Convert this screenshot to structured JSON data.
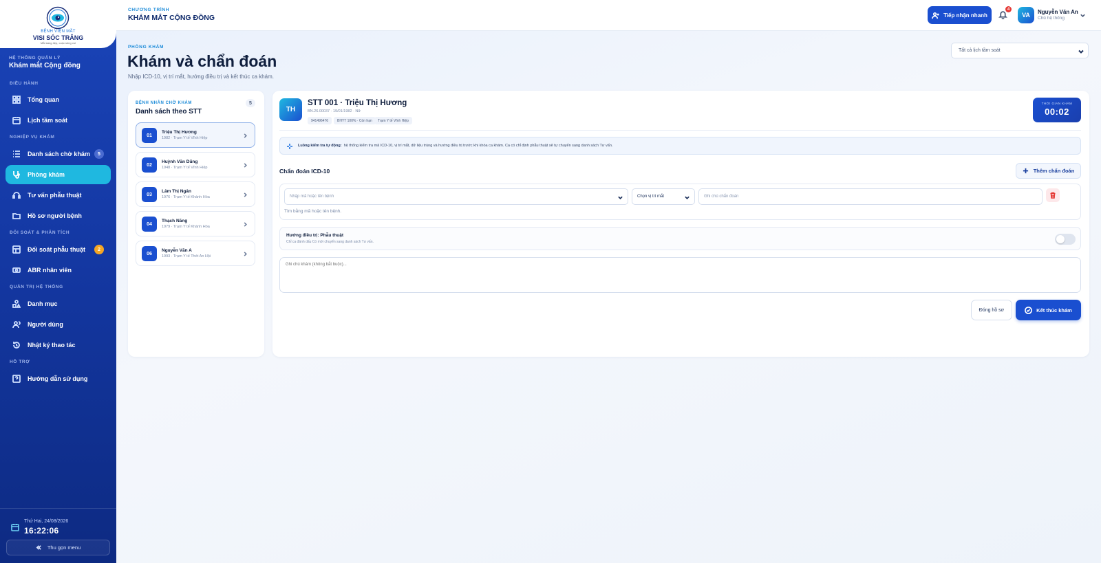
{
  "logo": {
    "line1": "BỆNH VIỆN MẮT",
    "line2": "VISI SÓC TRĂNG",
    "line3": "Mắt sáng đẹp, cuộc sống vui"
  },
  "sidebar": {
    "system_sub": "HỆ THỐNG QUẢN LÝ",
    "system_title": "Khám mắt Cộng đồng",
    "sections": {
      "dieu_hanh": "ĐIỀU HÀNH",
      "nghiep_vu": "NGHIỆP VỤ KHÁM",
      "doi_soat": "ĐỐI SOÁT & PHÂN TÍCH",
      "quan_tri": "QUẢN TRỊ HỆ THỐNG",
      "ho_tro": "HỖ TRỢ"
    },
    "items": {
      "tong_quan": "Tổng quan",
      "lich_tam_soat": "Lịch tầm soát",
      "danh_sach_cho_kham": "Danh sách chờ khám",
      "danh_sach_cho_kham_badge": "5",
      "phong_kham": "Phòng khám",
      "tu_van_phau_thuat": "Tư vấn phẫu thuật",
      "ho_so_nguoi_benh": "Hồ sơ người bệnh",
      "doi_soat_phau_thuat": "Đối soát phẫu thuật",
      "doi_soat_badge": "2",
      "abr_nhan_vien": "ABR nhân viên",
      "danh_muc": "Danh mục",
      "nguoi_dung": "Người dùng",
      "nhat_ky": "Nhật ký thao tác",
      "huong_dan": "Hướng dẫn sử dụng"
    },
    "date": "Thứ Hai, 24/08/2026",
    "time": "16:22:06",
    "collapse": "Thu gọn menu"
  },
  "topbar": {
    "program_sub": "CHƯƠNG TRÌNH",
    "program_title": "KHÁM MẮT CỘNG ĐỒNG",
    "quick_button": "Tiếp nhận nhanh",
    "notif_count": "4",
    "user_initials": "VA",
    "user_name": "Nguyễn Văn An",
    "user_role": "Chủ hệ thống"
  },
  "page": {
    "sub": "PHÒNG KHÁM",
    "title": "Khám và chẩn đoán",
    "desc": "Nhập ICD-10, vị trí mắt, hướng điều trị và kết thúc ca khám.",
    "filter_value": "Tất cả lịch tầm soát"
  },
  "queue": {
    "sub": "BỆNH NHÂN CHỜ KHÁM",
    "title": "Danh sách theo STT",
    "count": "5",
    "patients": [
      {
        "num": "01",
        "name": "Triệu Thị Hương",
        "meta": "1982 · Trạm Y tế Vĩnh Hiệp"
      },
      {
        "num": "02",
        "name": "Huỳnh Văn Dũng",
        "meta": "1948 · Trạm Y tế Vĩnh Hiệp"
      },
      {
        "num": "03",
        "name": "Lâm Thị Ngân",
        "meta": "1976 · Trạm Y tế Khánh Hòa"
      },
      {
        "num": "04",
        "name": "Thạch Năng",
        "meta": "1979 · Trạm Y tế Khánh Hòa"
      },
      {
        "num": "06",
        "name": "Nguyễn Văn A",
        "meta": "1993 · Trạm Y tế Thới An Hội"
      }
    ]
  },
  "exam": {
    "initials": "TH",
    "title": "STT 001 · Triệu Thị Hương",
    "meta": "BN.26.00037 · 19/01/1982 · Nữ",
    "chips": [
      "941496476",
      "BHYT 100% · Còn hạn",
      "Trạm Y tế Vĩnh Hiệp"
    ],
    "timer_label": "THỜI GIAN KHÁM",
    "timer_value": "00:02",
    "info_bold": "Luồng kiểm tra tự động:",
    "info_text": "hệ thống kiểm tra mã ICD-10, vị trí mắt, dữ liệu trùng và hướng điều trị trước khi khóa ca khám. Ca có chỉ định phẫu thuật sẽ tự chuyển sang danh sách Tư vấn.",
    "icd_label": "Chẩn đoán ICD-10",
    "add_button": "Thêm chẩn đoán",
    "icd_placeholder": "Nhập mã hoặc tên bệnh",
    "eye_select": "Chọn vị trí mắt",
    "note_placeholder": "Ghi chú chẩn đoán",
    "icd_help": "Tìm bằng mã hoặc tên bệnh.",
    "treatment_title": "Hướng điều trị: Phẫu thuật",
    "treatment_desc": "Chỉ ca đánh dấu Có mới chuyển sang danh sách Tư vấn.",
    "treatment_on": false,
    "exam_note_placeholder": "Ghi chú khám (không bắt buộc)...",
    "close_button": "Đóng hồ sơ",
    "finish_button": "Kết thúc khám"
  }
}
